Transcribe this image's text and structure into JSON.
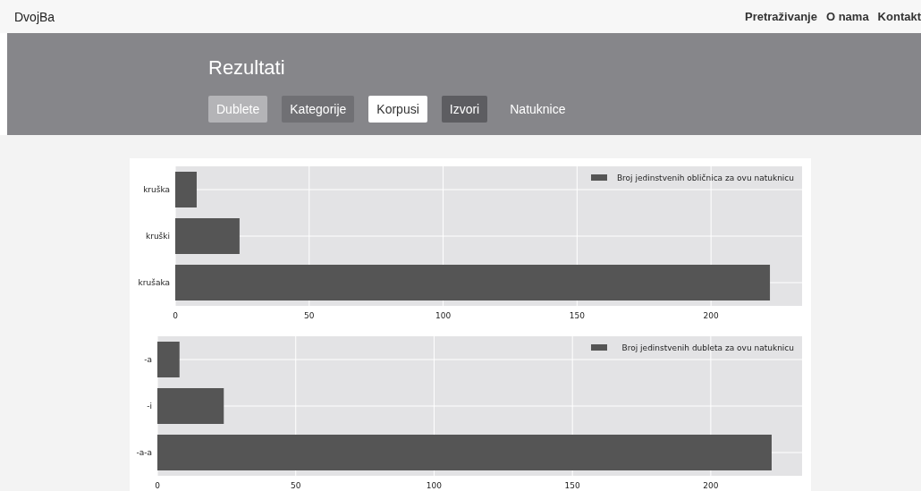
{
  "navbar": {
    "brand": "DvojBa",
    "links": [
      "Pretraživanje",
      "O nama",
      "Kontakt"
    ]
  },
  "header": {
    "title": "Rezultati",
    "tabs": [
      {
        "label": "Dublete",
        "kind": "light",
        "selected": false
      },
      {
        "label": "Kategorije",
        "kind": "medium",
        "selected": false
      },
      {
        "label": "Korpusi",
        "kind": "plain",
        "selected": true
      },
      {
        "label": "Izvori",
        "kind": "dark",
        "selected": false
      },
      {
        "label": "Natuknice",
        "kind": "plain",
        "selected": false
      }
    ]
  },
  "charts": [
    {
      "chart_data": {
        "type": "bar",
        "orientation": "horizontal",
        "categories": [
          "kruška",
          "kruški",
          "krušaka"
        ],
        "series": [
          {
            "name": "Broj jedinstvenih obličnica za ovu natuknicu",
            "color": "#555555",
            "values": [
              8,
              24,
              222
            ]
          }
        ],
        "xlim": [
          0,
          234
        ],
        "grid": true,
        "xticks": [
          0,
          50,
          100,
          150,
          200
        ]
      }
    },
    {
      "chart_data": {
        "type": "bar",
        "orientation": "horizontal",
        "categories": [
          "-a",
          "-i",
          "-a-a"
        ],
        "series": [
          {
            "name": "Broj jedinstvenih dubleta za ovu natuknicu",
            "color": "#555555",
            "values": [
              8,
              24,
              222
            ]
          }
        ],
        "xlim": [
          0,
          233
        ],
        "grid": true,
        "xticks": [
          0,
          50,
          100,
          150,
          200
        ]
      }
    }
  ]
}
